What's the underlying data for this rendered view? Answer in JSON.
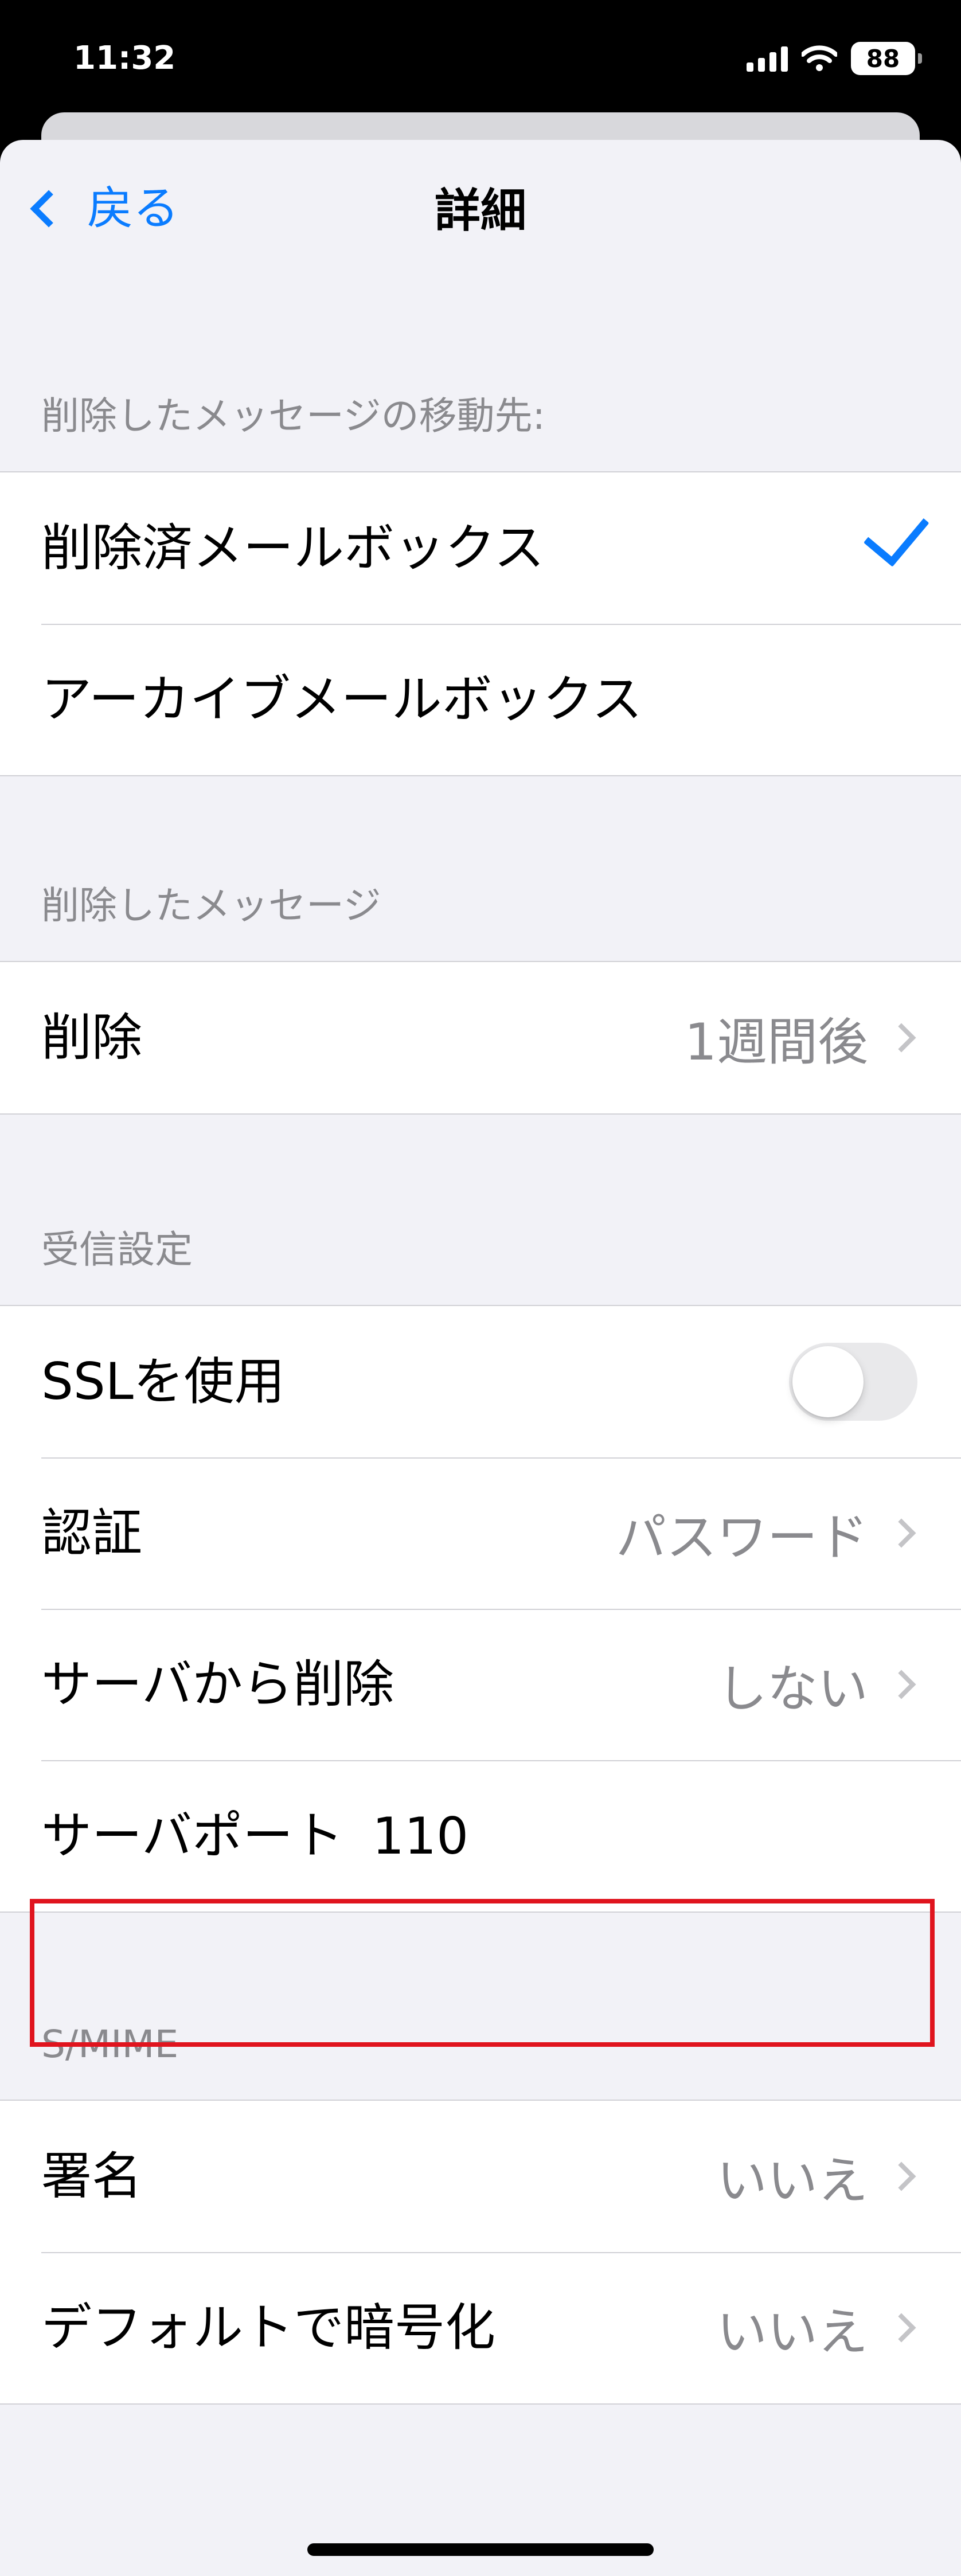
{
  "status_bar": {
    "time": "11:32",
    "battery": "88"
  },
  "nav": {
    "back_label": "戻る",
    "title": "詳細"
  },
  "sections": {
    "move_deleted": {
      "header": "削除したメッセージの移動先:",
      "items": [
        {
          "label": "削除済メールボックス",
          "selected": true
        },
        {
          "label": "アーカイブメールボックス",
          "selected": false
        }
      ]
    },
    "deleted_messages": {
      "header": "削除したメッセージ",
      "items": [
        {
          "label": "削除",
          "value": "1週間後"
        }
      ]
    },
    "incoming": {
      "header": "受信設定",
      "ssl": {
        "label": "SSLを使用",
        "on": false
      },
      "auth": {
        "label": "認証",
        "value": "パスワード"
      },
      "delete_from_server": {
        "label": "サーバから削除",
        "value": "しない"
      },
      "server_port": {
        "label": "サーバポート",
        "value": "110"
      }
    },
    "smime": {
      "header": "S/MIME",
      "sign": {
        "label": "署名",
        "value": "いいえ"
      },
      "encrypt": {
        "label": "デフォルトで暗号化",
        "value": "いいえ"
      }
    }
  },
  "colors": {
    "accent": "#0A7CFF",
    "highlight": "#E0141E",
    "background": "#F2F2F7",
    "secondary_text": "#8A8A8E"
  }
}
